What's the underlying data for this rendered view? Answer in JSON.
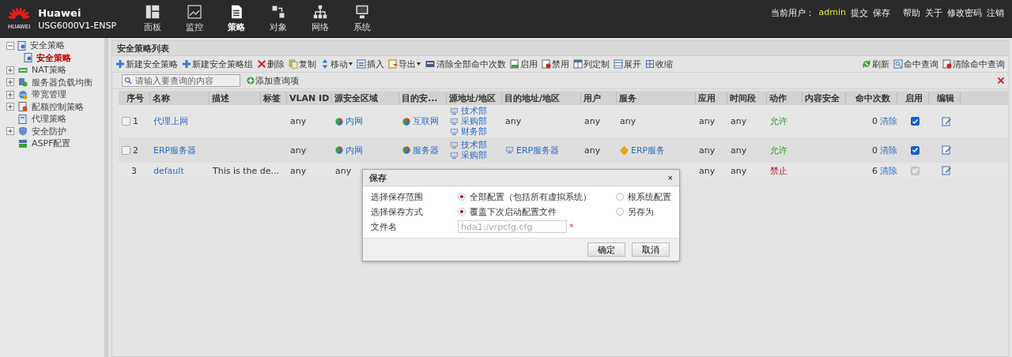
{
  "brand": {
    "logo_text": "HUAWEI",
    "title": "Huawei",
    "model": "USG6000V1-ENSP"
  },
  "nav": [
    {
      "label": "面板",
      "selected": false
    },
    {
      "label": "监控",
      "selected": false
    },
    {
      "label": "策略",
      "selected": true
    },
    {
      "label": "对象",
      "selected": false
    },
    {
      "label": "网络",
      "selected": false
    },
    {
      "label": "系统",
      "selected": false
    }
  ],
  "user_bar": {
    "user_label": "当前用户：",
    "user": "admin",
    "links": [
      "提交",
      "保存",
      "帮助",
      "关于",
      "修改密码",
      "注销"
    ]
  },
  "sidebar": {
    "items": [
      {
        "label": "安全策略",
        "expanded": true,
        "children": [
          {
            "label": "安全策略",
            "selected": true
          }
        ]
      },
      {
        "label": "NAT策略",
        "expanded": false
      },
      {
        "label": "服务器负载均衡",
        "expanded": false
      },
      {
        "label": "带宽管理",
        "expanded": false
      },
      {
        "label": "配额控制策略",
        "expanded": false
      },
      {
        "label": "代理策略"
      },
      {
        "label": "安全防护",
        "expanded": false
      },
      {
        "label": "ASPF配置"
      }
    ]
  },
  "panel": {
    "title": "安全策略列表",
    "toolbar": [
      {
        "label": "新建安全策略"
      },
      {
        "label": "新建安全策略组"
      },
      {
        "label": "删除"
      },
      {
        "label": "复制"
      },
      {
        "label": "移动",
        "dropdown": true
      },
      {
        "label": "插入"
      },
      {
        "label": "导出",
        "dropdown": true
      },
      {
        "label": "清除全部命中次数"
      },
      {
        "label": "启用"
      },
      {
        "label": "禁用"
      },
      {
        "label": "列定制"
      },
      {
        "label": "展开"
      },
      {
        "label": "收缩"
      }
    ],
    "toolbar_right": [
      "刷新",
      "命中查询",
      "清除命中查询"
    ],
    "search": {
      "placeholder": "请输入要查询的内容",
      "add_label": "添加查询项"
    },
    "table": {
      "columns": [
        "序号",
        "名称",
        "描述",
        "标签",
        "VLAN ID",
        "源安全区域",
        "目的安...",
        "源地址/地区",
        "目的地址/地区",
        "用户",
        "服务",
        "应用",
        "时间段",
        "动作",
        "内容安全",
        "命中次数",
        "启用",
        "编辑"
      ],
      "rows": [
        {
          "selected": false,
          "index": "1",
          "name": "代理上网",
          "vlan": "any",
          "src_zone": {
            "text": "内网",
            "kind": "zone"
          },
          "dst_zone": {
            "text": "互联网",
            "kind": "zone"
          },
          "src_addr": [
            "技术部",
            "采购部",
            "财务部"
          ],
          "dst_addr": {
            "text": "any",
            "kind": "plain"
          },
          "user": "any",
          "service": {
            "text": "any",
            "kind": "plain"
          },
          "app": "any",
          "time": "any",
          "action": {
            "text": "允许",
            "kind": "permit"
          },
          "hits": "0",
          "clear": "清除",
          "enabled": {
            "checked": true,
            "disabled": false
          }
        },
        {
          "selected": false,
          "index": "2",
          "name": "ERP服务器",
          "vlan": "any",
          "src_zone": {
            "text": "内网",
            "kind": "zone"
          },
          "dst_zone": {
            "text": "服务器",
            "kind": "zone"
          },
          "src_addr": [
            "技术部",
            "采购部"
          ],
          "dst_addr": {
            "text": "ERP服务器",
            "kind": "address"
          },
          "user": "any",
          "service": {
            "text": "ERP服务",
            "kind": "service"
          },
          "app": "any",
          "time": "any",
          "action": {
            "text": "允许",
            "kind": "permit"
          },
          "hits": "0",
          "clear": "清除",
          "enabled": {
            "checked": true,
            "disabled": false
          }
        },
        {
          "index": "3",
          "name": "default",
          "description": "This is the de...",
          "vlan": "any",
          "src_zone": {
            "text": "any",
            "kind": "plain"
          },
          "app": "any",
          "time": "any",
          "action": {
            "text": "禁止",
            "kind": "deny"
          },
          "hits": "6",
          "clear": "清除",
          "enabled": {
            "checked": true,
            "disabled": true
          }
        }
      ]
    }
  },
  "dialog": {
    "title": "保存",
    "close": "×",
    "rows": [
      {
        "label": "选择保存范围",
        "kind": "radio",
        "options": [
          {
            "label": "全部配置（包括所有虚拟系统）",
            "selected": true
          },
          {
            "label": "根系统配置",
            "selected": false
          }
        ]
      },
      {
        "label": "选择保存方式",
        "kind": "radio",
        "options": [
          {
            "label": "覆盖下次启动配置文件",
            "selected": true
          },
          {
            "label": "另存为",
            "selected": false
          }
        ]
      },
      {
        "label": "文件名",
        "kind": "field",
        "value": "hda1:/vrpcfg.cfg",
        "disabled": true,
        "required": "*"
      }
    ],
    "buttons": [
      "确定",
      "取消"
    ]
  }
}
